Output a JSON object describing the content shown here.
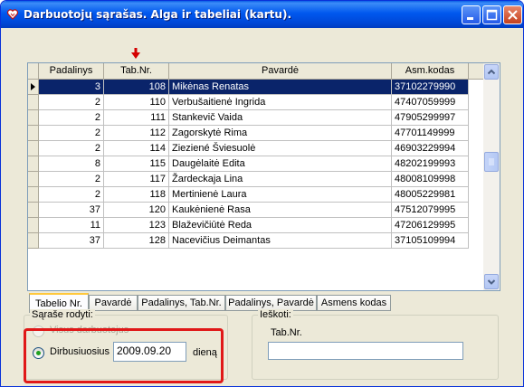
{
  "window": {
    "title": "Darbuotojų sąrašas. Alga ir tabeliai (kartu)."
  },
  "grid": {
    "columns": [
      "Padalinys",
      "Tab.Nr.",
      "Pavardė",
      "Asm.kodas"
    ],
    "sort_column": "Tab.Nr.",
    "selected_row": 0,
    "rows": [
      {
        "padalinys": "3",
        "tab": "108",
        "name": "Mikėnas Renatas",
        "code": "37102279990"
      },
      {
        "padalinys": "2",
        "tab": "110",
        "name": "Verbušaitienė Ingrida",
        "code": "47407059999"
      },
      {
        "padalinys": "2",
        "tab": "111",
        "name": "Stankevič Vaida",
        "code": "47905299997"
      },
      {
        "padalinys": "2",
        "tab": "112",
        "name": "Zagorskytė Rima",
        "code": "47701149999"
      },
      {
        "padalinys": "2",
        "tab": "114",
        "name": "Zieziené Šviesuolė",
        "code": "46903229994"
      },
      {
        "padalinys": "8",
        "tab": "115",
        "name": "Daugėlaitė Edita",
        "code": "48202199993"
      },
      {
        "padalinys": "2",
        "tab": "117",
        "name": "Žardeckaja Lina",
        "code": "48008109998"
      },
      {
        "padalinys": "2",
        "tab": "118",
        "name": "Mertinienė Laura",
        "code": "48005229981"
      },
      {
        "padalinys": "37",
        "tab": "120",
        "name": "Kaukėnienė Rasa",
        "code": "47512079995"
      },
      {
        "padalinys": "11",
        "tab": "123",
        "name": "Blaževičiūtė Reda",
        "code": "47206129995"
      },
      {
        "padalinys": "37",
        "tab": "128",
        "name": "Nacevičius Deimantas",
        "code": "37105109994"
      }
    ]
  },
  "tabs": [
    {
      "label": "Tabelio Nr.",
      "active": true
    },
    {
      "label": "Pavardė",
      "active": false
    },
    {
      "label": "Padalinys, Tab.Nr.",
      "active": false
    },
    {
      "label": "Padalinys, Pavardė",
      "active": false
    },
    {
      "label": "Asmens kodas",
      "active": false
    }
  ],
  "show_group": {
    "legend": "Sąraše rodyti:",
    "option_all": "Visus darbuotojus",
    "option_working": "Dirbusiuosius",
    "date_value": "2009.09.20",
    "date_suffix": "dieną",
    "selected": "working"
  },
  "search_group": {
    "legend": "Ieškoti:",
    "field_label": "Tab.Nr.",
    "field_value": ""
  },
  "colors": {
    "selection": "#0a246a",
    "highlight": "#e01818",
    "sort_arrow": "#d40000"
  }
}
